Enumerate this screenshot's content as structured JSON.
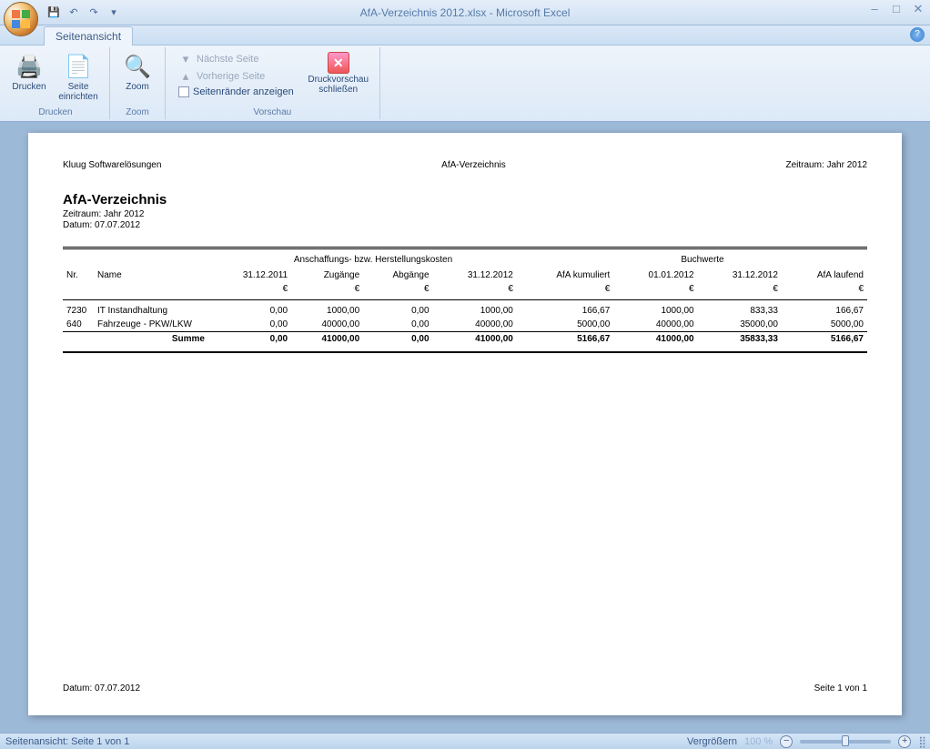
{
  "window": {
    "title": "AfA-Verzeichnis 2012.xlsx - Microsoft Excel"
  },
  "tabs": {
    "active": "Seitenansicht"
  },
  "ribbon": {
    "groups": {
      "drucken": {
        "label": "Drucken",
        "print": "Drucken",
        "pagesetup": "Seite einrichten"
      },
      "zoom": {
        "label": "Zoom",
        "zoom": "Zoom"
      },
      "vorschau": {
        "label": "Vorschau",
        "nextpage": "Nächste Seite",
        "prevpage": "Vorherige Seite",
        "margins": "Seitenränder anzeigen",
        "close": "Druckvorschau schließen"
      }
    }
  },
  "report": {
    "header_left": "Kluug Softwarelösungen",
    "header_center": "AfA-Verzeichnis",
    "header_right": "Zeitraum: Jahr 2012",
    "title": "AfA-Verzeichnis",
    "subtitle1": "Zeitraum: Jahr 2012",
    "subtitle2": "Datum: 07.07.2012",
    "section1": "Anschaffungs- bzw. Herstellungskosten",
    "section2": "Buchwerte",
    "cols": {
      "nr": "Nr.",
      "name": "Name",
      "c1": "31.12.2011",
      "c2": "Zugänge",
      "c3": "Abgänge",
      "c4": "31.12.2012",
      "c5": "AfA kumuliert",
      "c6": "01.01.2012",
      "c7": "31.12.2012",
      "c8": "AfA laufend"
    },
    "unit": "€",
    "rows": [
      {
        "nr": "7230",
        "name": "IT Instandhaltung",
        "v": [
          "0,00",
          "1000,00",
          "0,00",
          "1000,00",
          "166,67",
          "1000,00",
          "833,33",
          "166,67"
        ]
      },
      {
        "nr": "640",
        "name": "Fahrzeuge - PKW/LKW",
        "v": [
          "0,00",
          "40000,00",
          "0,00",
          "40000,00",
          "5000,00",
          "40000,00",
          "35000,00",
          "5000,00"
        ]
      }
    ],
    "sum_label": "Summe",
    "sum": [
      "0,00",
      "41000,00",
      "0,00",
      "41000,00",
      "5166,67",
      "41000,00",
      "35833,33",
      "5166,67"
    ],
    "footer_left": "Datum: 07.07.2012",
    "footer_right": "Seite 1 von 1"
  },
  "statusbar": {
    "left": "Seitenansicht: Seite 1 von 1",
    "zoom_hint": "Vergrößern",
    "zoom_pct": "100 %"
  }
}
